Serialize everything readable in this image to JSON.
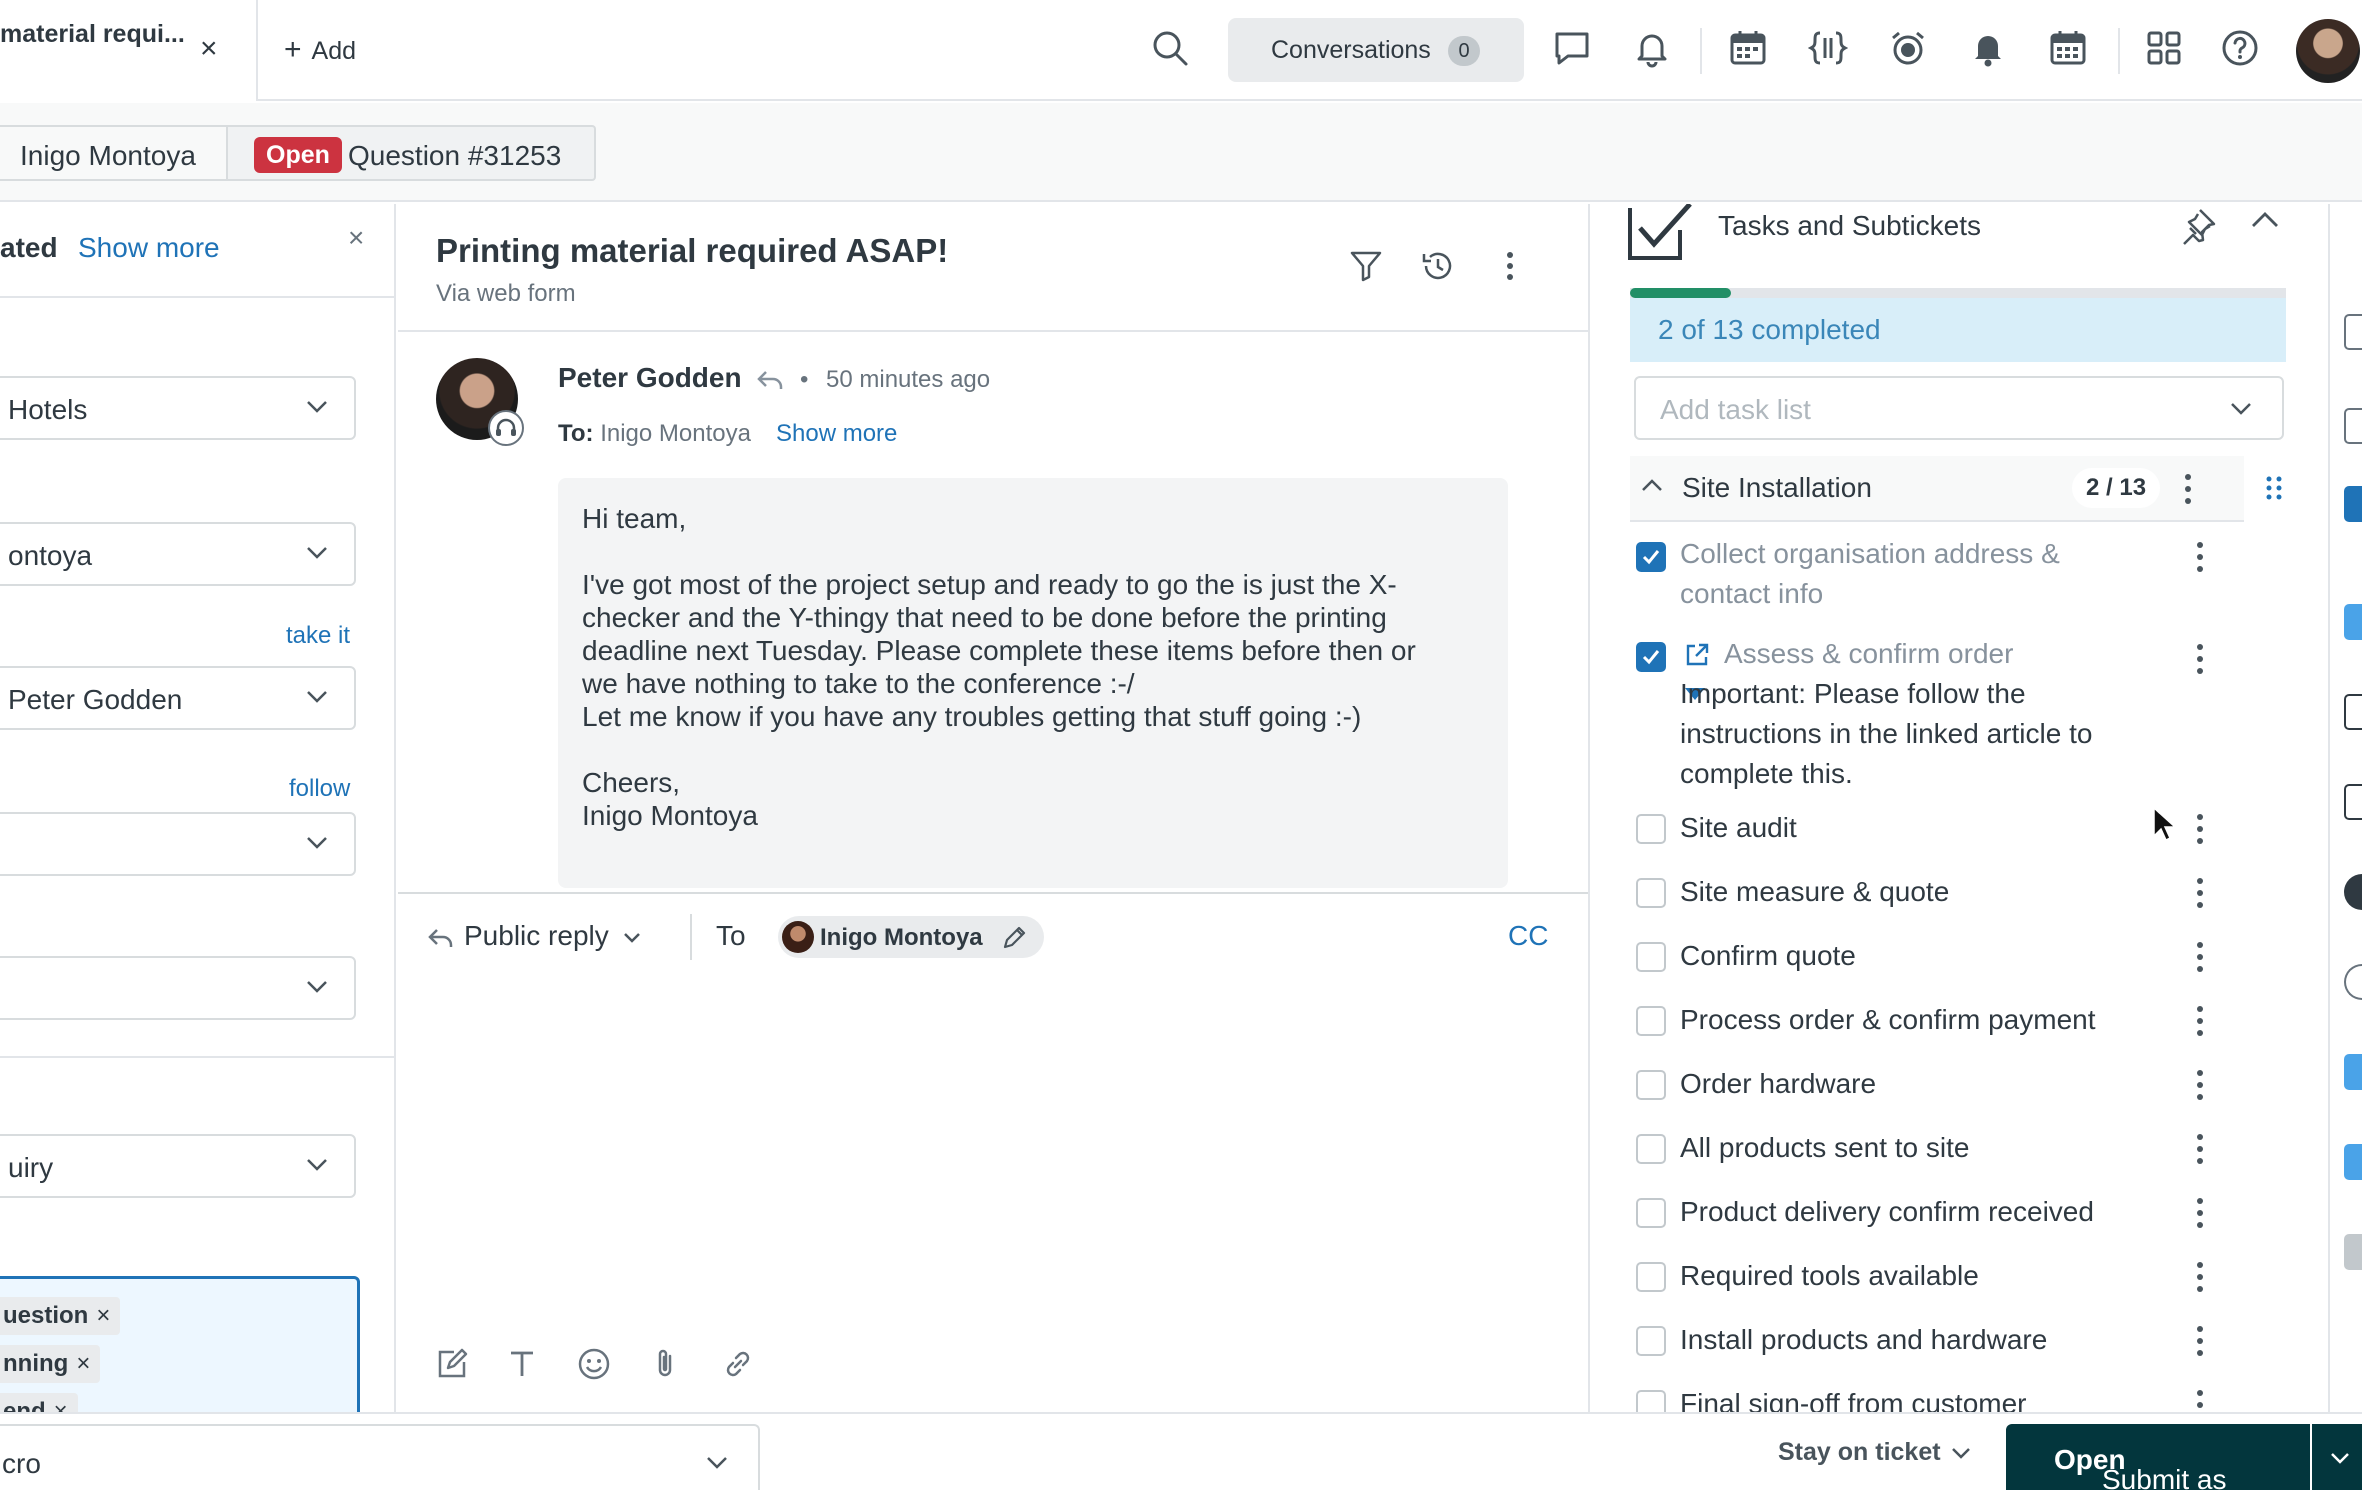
{
  "topbar": {
    "active_tab_title": "material requi...",
    "active_tab_close": "×",
    "add_tab_label": "Add",
    "conversations_label": "Conversations",
    "conversations_count": "0"
  },
  "breadcrumb": {
    "requester": "Inigo Montoya",
    "status": "Open",
    "ticket": "Question #31253"
  },
  "left_panel": {
    "heading": "ated",
    "show_more": "Show more",
    "fields": [
      {
        "value": "Hotels"
      },
      {
        "value": "ontoya"
      },
      {
        "value": "Peter Godden"
      },
      {
        "value": ""
      },
      {
        "value": ""
      },
      {
        "value": "uiry"
      }
    ],
    "take_it": "take it",
    "follow": "follow",
    "tags": [
      "uestion",
      "nning",
      "end"
    ]
  },
  "conversation": {
    "title": "Printing material required ASAP!",
    "via": "Via web form",
    "author": "Peter Godden",
    "time": "50 minutes ago",
    "to_label": "To:",
    "to_name": "Inigo Montoya",
    "show_more": "Show more",
    "body": [
      "Hi team,",
      "I've got most of the project setup and ready to go the is just the X-\nchecker and the Y-thingy that need to be done before the printing\ndeadline next Tuesday. Please complete these items before then or\nwe have nothing to take to the conference :-/",
      "Let me know if you have any troubles getting that stuff going :-)",
      "Cheers,\nInigo Montoya"
    ]
  },
  "reply": {
    "type": "Public reply",
    "to_label": "To",
    "recipient": "Inigo Montoya",
    "cc": "CC"
  },
  "tasks_panel": {
    "title": "Tasks and Subtickets",
    "completed_fraction": 0.154,
    "completed_label": "2 of 13 completed",
    "add_task_list_placeholder": "Add task list",
    "group_name": "Site Installation",
    "group_count": "2 / 13",
    "tasks": [
      {
        "label": "Collect organisation address &\ncontact info",
        "done": true
      },
      {
        "label": "Assess & confirm order",
        "done": true,
        "note": "Important: Please follow the\ninstructions in the linked article to\ncomplete this."
      },
      {
        "label": "Site audit",
        "done": false
      },
      {
        "label": "Site measure & quote",
        "done": false
      },
      {
        "label": "Confirm quote",
        "done": false
      },
      {
        "label": "Process order & confirm payment",
        "done": false
      },
      {
        "label": "Order hardware",
        "done": false
      },
      {
        "label": "All products sent to site",
        "done": false
      },
      {
        "label": "Product delivery confirm received",
        "done": false
      },
      {
        "label": "Required tools available",
        "done": false
      },
      {
        "label": "Install products and hardware",
        "done": false
      },
      {
        "label": "Final sign-off from customer",
        "done": false
      }
    ]
  },
  "bottombar": {
    "macro": "cro",
    "stay_label": "Stay on ticket",
    "submit_prefix": "Submit as",
    "submit_status": "Open"
  },
  "colors": {
    "brand_dark": "#03363d",
    "link_blue": "#1f73b7",
    "open_red": "#cc3340",
    "progress_green": "#228f67"
  }
}
